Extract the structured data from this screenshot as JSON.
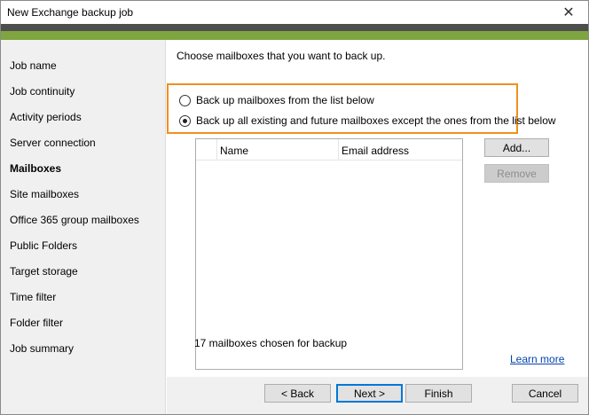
{
  "window": {
    "title": "New Exchange backup job",
    "close_glyph": "✕"
  },
  "colors": {
    "accent_green": "#7ea540",
    "band_dark": "#4d4d4d",
    "highlight_orange": "#f0901e",
    "link_blue": "#0645ad"
  },
  "sidebar": {
    "items": [
      {
        "label": "Job name",
        "active": false
      },
      {
        "label": "Job continuity",
        "active": false
      },
      {
        "label": "Activity periods",
        "active": false
      },
      {
        "label": "Server connection",
        "active": false
      },
      {
        "label": "Mailboxes",
        "active": true
      },
      {
        "label": "Site mailboxes",
        "active": false
      },
      {
        "label": "Office 365 group mailboxes",
        "active": false
      },
      {
        "label": "Public Folders",
        "active": false
      },
      {
        "label": "Target storage",
        "active": false
      },
      {
        "label": "Time filter",
        "active": false
      },
      {
        "label": "Folder filter",
        "active": false
      },
      {
        "label": "Job summary",
        "active": false
      }
    ]
  },
  "main": {
    "heading": "Choose mailboxes that you want to back up.",
    "options": [
      {
        "label": "Back up mailboxes from the list below",
        "checked": false
      },
      {
        "label": "Back up all existing and future mailboxes except the ones from the list below",
        "checked": true
      }
    ],
    "list": {
      "columns": [
        "Name",
        "Email address"
      ],
      "rows": []
    },
    "add_label": "Add...",
    "remove_label": "Remove",
    "status": "17 mailboxes chosen for backup",
    "learn_more": "Learn more"
  },
  "footer": {
    "back_label": "< Back",
    "next_label": "Next >",
    "finish_label": "Finish",
    "cancel_label": "Cancel"
  }
}
